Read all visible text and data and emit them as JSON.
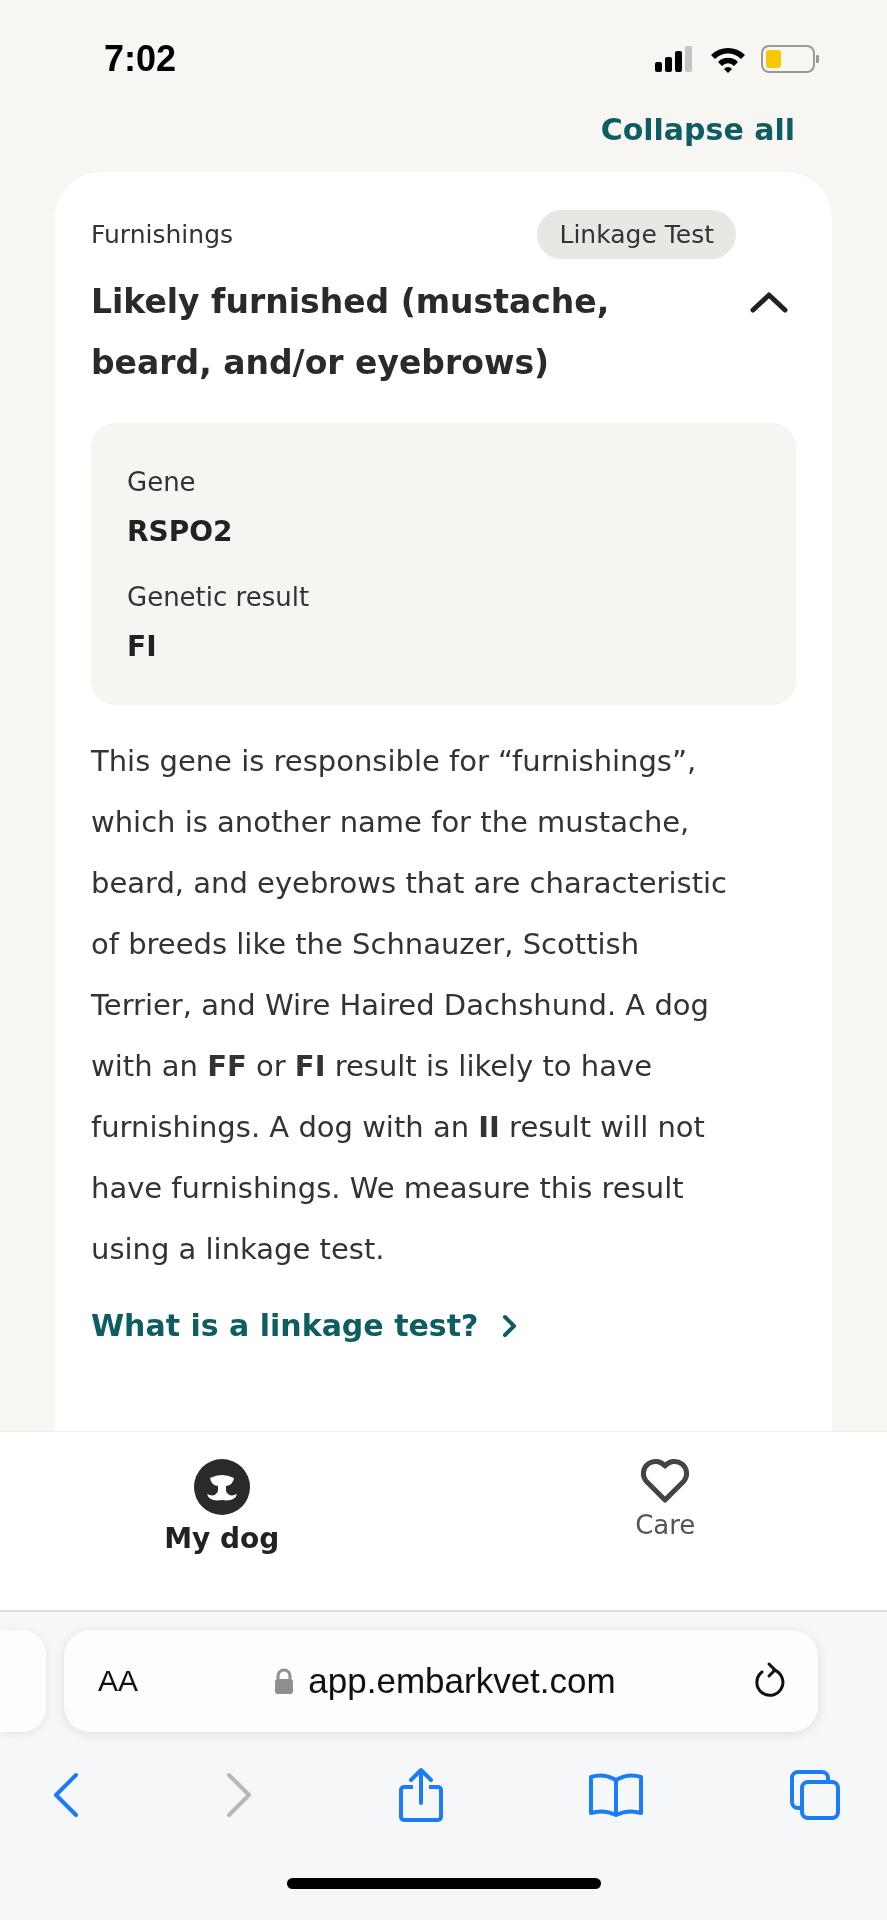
{
  "status_bar": {
    "time": "7:02"
  },
  "header": {
    "collapse_link": "Collapse all"
  },
  "trait_card": {
    "category": "Furnishings",
    "badge": "Linkage Test",
    "title": "Likely furnished (mustache, beard, and/or eyebrows)",
    "expanded": true,
    "details": [
      {
        "label": "Gene",
        "value": "RSPO2"
      },
      {
        "label": "Genetic result",
        "value": "FI"
      }
    ],
    "description": "This gene is responsible for “furnishings”, which is another name for the mustache, beard, and eyebrows that are characteristic of breeds like the Schnauzer, Scottish Terrier, and Wire Haired Dachshund. A dog with an **FF** or **FI** result is likely to have furnishings. A dog with an **II** result will not have furnishings. We measure this result using a linkage test.",
    "link": "What is a linkage test?"
  },
  "tab_bar": {
    "tabs": [
      {
        "label": "My dog",
        "kind": "dog",
        "selected": true
      },
      {
        "label": "Care",
        "kind": "heart",
        "selected": false
      }
    ]
  },
  "browser": {
    "text_size_button": "AA",
    "url": "app.embarkvet.com",
    "toolbar": [
      {
        "kind": "back",
        "disabled": false
      },
      {
        "kind": "forward",
        "disabled": true
      },
      {
        "kind": "share",
        "disabled": false
      },
      {
        "kind": "bookmarks",
        "disabled": false
      },
      {
        "kind": "tabs",
        "disabled": false
      }
    ]
  }
}
